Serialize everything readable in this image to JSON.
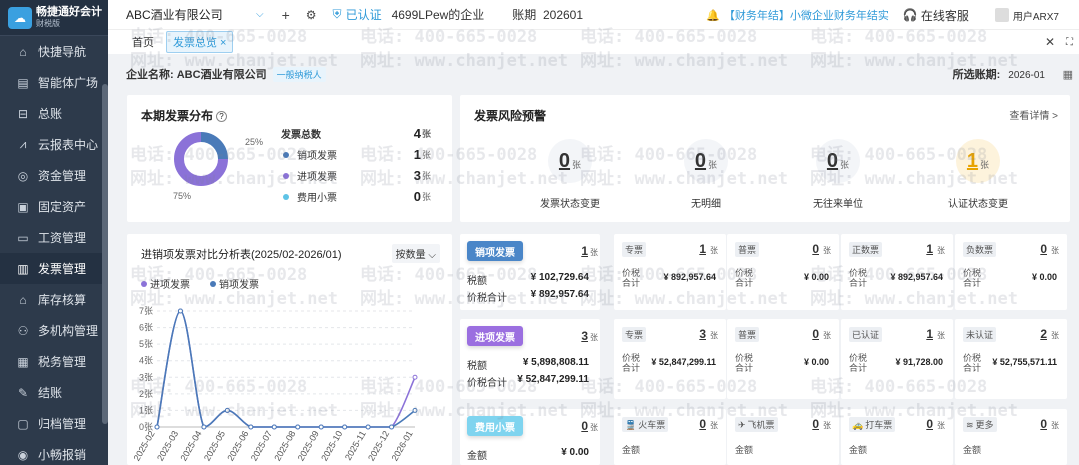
{
  "app": {
    "logo_line1": "畅捷通好会计",
    "logo_line2": "财税版"
  },
  "sidebar": {
    "items": [
      {
        "label": "快捷导航",
        "icon": "home-icon",
        "name": "sidebar-item-quick-nav"
      },
      {
        "label": "智能体广场",
        "icon": "book-icon",
        "name": "sidebar-item-agent-square"
      },
      {
        "label": "总账",
        "icon": "ledger-icon",
        "name": "sidebar-item-general-ledger"
      },
      {
        "label": "云报表中心",
        "icon": "chart-icon",
        "name": "sidebar-item-report-center"
      },
      {
        "label": "资金管理",
        "icon": "coin-icon",
        "name": "sidebar-item-funds"
      },
      {
        "label": "固定资产",
        "icon": "asset-icon",
        "name": "sidebar-item-fixed-assets"
      },
      {
        "label": "工资管理",
        "icon": "salary-icon",
        "name": "sidebar-item-salary"
      },
      {
        "label": "发票管理",
        "icon": "invoice-icon",
        "name": "sidebar-item-invoice"
      },
      {
        "label": "库存核算",
        "icon": "warehouse-icon",
        "name": "sidebar-item-inventory"
      },
      {
        "label": "多机构管理",
        "icon": "org-icon",
        "name": "sidebar-item-multi-org"
      },
      {
        "label": "税务管理",
        "icon": "tax-icon",
        "name": "sidebar-item-tax"
      },
      {
        "label": "结账",
        "icon": "close-book-icon",
        "name": "sidebar-item-closing"
      },
      {
        "label": "归档管理",
        "icon": "archive-icon",
        "name": "sidebar-item-archive"
      },
      {
        "label": "小畅报销",
        "icon": "reimburse-icon",
        "name": "sidebar-item-reimburse"
      }
    ],
    "active_index": 7
  },
  "topbar": {
    "company": "ABC酒业有限公司",
    "cert_label": "已认证",
    "org": "4699LPew的企业",
    "period_label": "账期",
    "period_value": "202601",
    "notice": "【财务年结】小微企业财务年结实",
    "service": "在线客服",
    "user": "用户ARX7"
  },
  "tabs": {
    "home": "首页",
    "active": "发票总览",
    "active_close": "×"
  },
  "info": {
    "company_label": "企业名称:",
    "company": "ABC酒业有限公司",
    "tax_type": "一般纳税人",
    "period_label": "所选账期:",
    "period": "2026-01"
  },
  "distribution": {
    "title": "本期发票分布",
    "pct_sales": "25%",
    "pct_purchase": "75%",
    "total_label": "发票总数",
    "total": "4",
    "unit": "张",
    "rows": [
      {
        "label": "销项发票",
        "value": "1",
        "color": "#4a7ab8"
      },
      {
        "label": "进项发票",
        "value": "3",
        "color": "#8b72d8"
      },
      {
        "label": "费用小票",
        "value": "0",
        "color": "#5ec3e6"
      }
    ],
    "fractions": {
      "sales": 0.25,
      "purchase": 0.75
    }
  },
  "risk": {
    "title": "发票风险预警",
    "more": "查看详情 >",
    "unit": "张",
    "items": [
      {
        "value": "0",
        "label": "发票状态变更",
        "highlight": false
      },
      {
        "value": "0",
        "label": "无明细",
        "highlight": false
      },
      {
        "value": "0",
        "label": "无往来单位",
        "highlight": false
      },
      {
        "value": "1",
        "label": "认证状态变更",
        "highlight": true
      }
    ]
  },
  "chart_data": {
    "type": "line",
    "title": "进销项发票对比分析表(2025/02-2026/01)",
    "selector": "按数量",
    "categories": [
      "2025-02",
      "2025-03",
      "2025-04",
      "2025-05",
      "2025-06",
      "2025-07",
      "2025-08",
      "2025-09",
      "2025-10",
      "2025-11",
      "2025-12",
      "2026-01"
    ],
    "series": [
      {
        "name": "进项发票",
        "color": "#8b72d8",
        "values": [
          0,
          7,
          0,
          1,
          0,
          0,
          0,
          0,
          0,
          0,
          0,
          3
        ]
      },
      {
        "name": "销项发票",
        "color": "#4a7ab8",
        "values": [
          0,
          7,
          0,
          1,
          0,
          0,
          0,
          0,
          0,
          0,
          0,
          1
        ]
      }
    ],
    "y_ticks": [
      "0张",
      "1张",
      "2张",
      "3张",
      "4张",
      "5张",
      "6张",
      "7张"
    ],
    "ylim": [
      0,
      7
    ]
  },
  "sales_invoice": {
    "button": "销项发票",
    "count": "1",
    "unit": "张",
    "tax_label": "税额",
    "tax": "¥ 102,729.64",
    "total_label": "价税合计",
    "total": "¥ 892,957.64",
    "color": "#4a86c8",
    "cells": [
      {
        "tag": "专票",
        "count": "1",
        "label": "价税合计",
        "amount": "¥ 892,957.64"
      },
      {
        "tag": "普票",
        "count": "0",
        "label": "价税合计",
        "amount": "¥ 0.00"
      },
      {
        "tag": "正数票",
        "count": "1",
        "label": "价税合计",
        "amount": "¥ 892,957.64"
      },
      {
        "tag": "负数票",
        "count": "0",
        "label": "价税合计",
        "amount": "¥ 0.00"
      }
    ]
  },
  "purchase_invoice": {
    "button": "进项发票",
    "count": "3",
    "unit": "张",
    "tax_label": "税额",
    "tax": "¥ 5,898,808.11",
    "total_label": "价税合计",
    "total": "¥ 52,847,299.11",
    "color": "#9b6fe0",
    "cells": [
      {
        "tag": "专票",
        "count": "3",
        "label": "价税合计",
        "amount": "¥ 52,847,299.11"
      },
      {
        "tag": "普票",
        "count": "0",
        "label": "价税合计",
        "amount": "¥ 0.00"
      },
      {
        "tag": "已认证",
        "count": "1",
        "label": "价税合计",
        "amount": "¥ 91,728.00"
      },
      {
        "tag": "未认证",
        "count": "2",
        "label": "价税合计",
        "amount": "¥ 52,755,571.11"
      }
    ]
  },
  "expense_receipt": {
    "button": "费用小票",
    "count": "0",
    "unit": "张",
    "amount_label": "金额",
    "amount": "¥ 0.00",
    "color": "#7fd4ef",
    "cells": [
      {
        "tag": "火车票",
        "icon": "train-icon",
        "glyph": "🚆",
        "count": "0",
        "label": "金额"
      },
      {
        "tag": "飞机票",
        "icon": "plane-icon",
        "glyph": "✈",
        "count": "0",
        "label": "金额"
      },
      {
        "tag": "打车票",
        "icon": "car-icon",
        "glyph": "🚕",
        "count": "0",
        "label": "金额"
      },
      {
        "tag": "更多",
        "icon": "stack-icon",
        "glyph": "≋",
        "count": "0",
        "label": "金额"
      }
    ]
  },
  "watermark": {
    "phone": "电话: 400-665-0028",
    "site": "网址: www.chanjet.net"
  }
}
